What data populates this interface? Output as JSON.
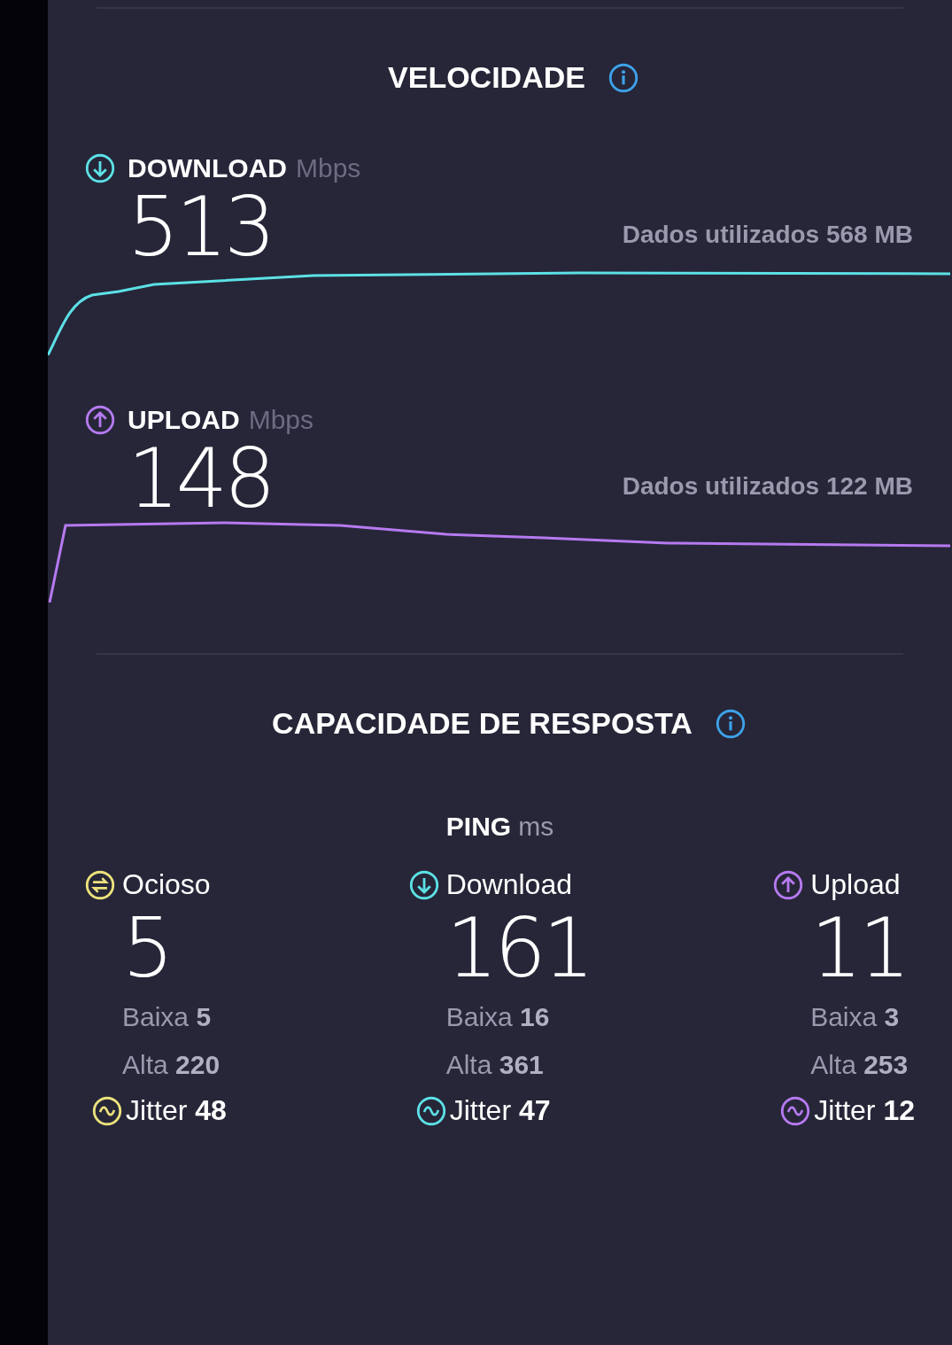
{
  "speed": {
    "title": "VELOCIDADE",
    "metrics": [
      {
        "kind": "download",
        "label": "DOWNLOAD",
        "unit": "Mbps",
        "value": "513",
        "data_used": "Dados utilizados 568 MB",
        "color": "#5ce1e6"
      },
      {
        "kind": "upload",
        "label": "UPLOAD",
        "unit": "Mbps",
        "value": "148",
        "data_used": "Dados utilizados 122 MB",
        "color": "#b67af0"
      }
    ]
  },
  "responsiveness": {
    "title": "CAPACIDADE DE RESPOSTA",
    "ping_label": "PING",
    "ping_unit": "ms",
    "items": [
      {
        "kind": "idle",
        "label": "Ocioso",
        "value": "5",
        "low": "Baixa **5**",
        "high": "Alta **220**",
        "jitter": "Jitter **48**",
        "color": "#ece27c"
      },
      {
        "kind": "download",
        "label": "Download",
        "value": "161",
        "low": "Baixa **16**",
        "high": "Alta **361**",
        "jitter": "Jitter **47**",
        "color": "#5ce1e6"
      },
      {
        "kind": "upload",
        "label": "Upload",
        "value": "11",
        "low": "Baixa **3**",
        "high": "Alta **253**",
        "jitter": "Jitter **12**",
        "color": "#b67af0"
      }
    ]
  }
}
